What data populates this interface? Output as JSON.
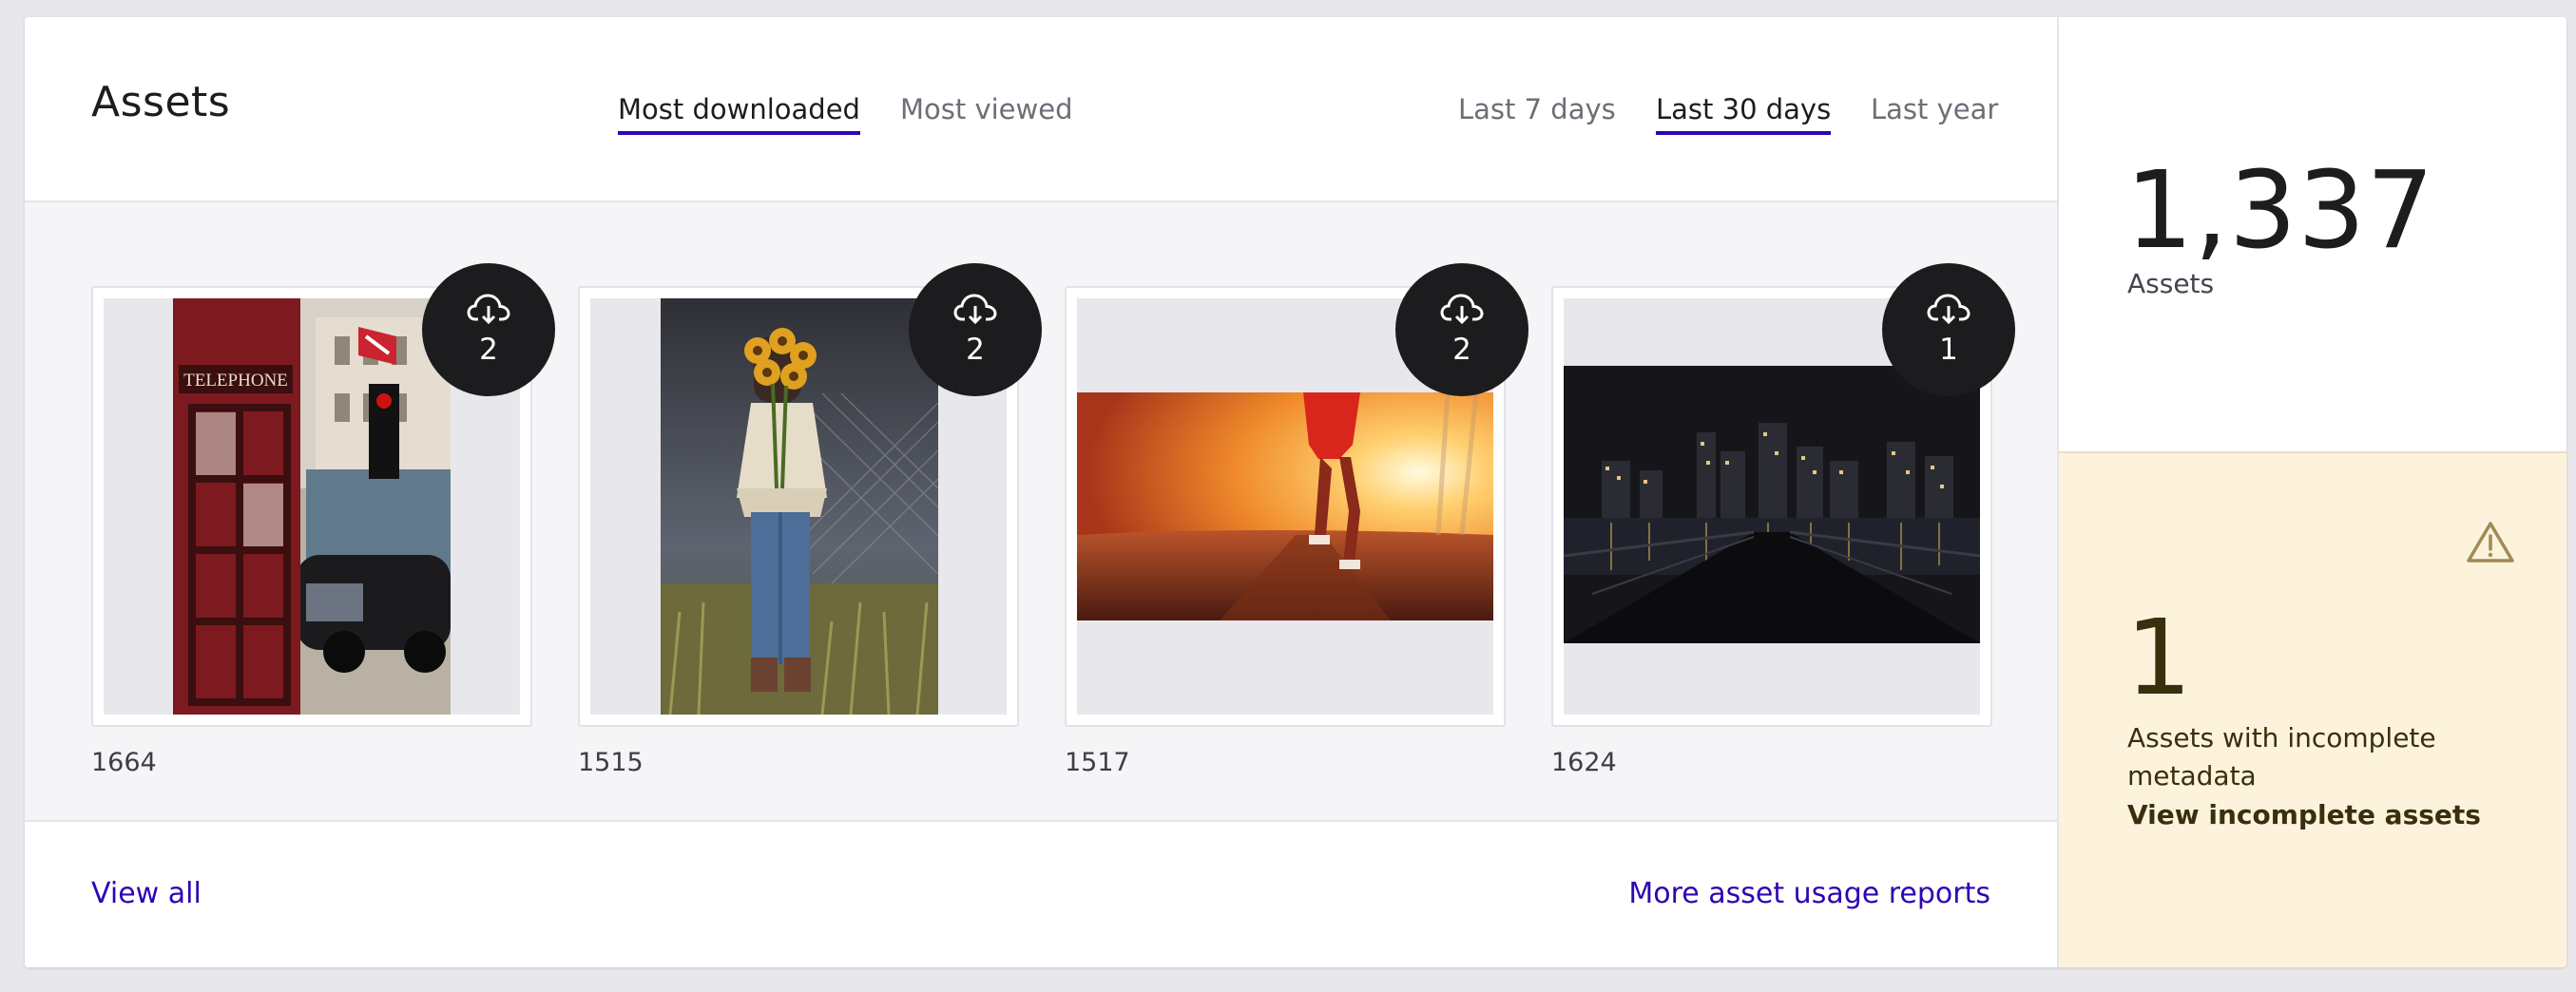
{
  "header": {
    "title": "Assets",
    "metric_tabs": [
      {
        "label": "Most downloaded",
        "active": true
      },
      {
        "label": "Most viewed",
        "active": false
      }
    ],
    "period_tabs": [
      {
        "label": "Last 7 days",
        "active": false
      },
      {
        "label": "Last 30 days",
        "active": true
      },
      {
        "label": "Last year",
        "active": false
      }
    ]
  },
  "assets": [
    {
      "id": "1664",
      "downloads": "2",
      "icon": "cloud-download-icon",
      "image": "red telephone box with taxi"
    },
    {
      "id": "1515",
      "downloads": "2",
      "icon": "cloud-download-icon",
      "image": "person holding sunflowers"
    },
    {
      "id": "1517",
      "downloads": "2",
      "icon": "cloud-download-icon",
      "image": "runner at sunset"
    },
    {
      "id": "1624",
      "downloads": "1",
      "icon": "cloud-download-icon",
      "image": "city skyline at night"
    }
  ],
  "footer": {
    "view_all": "View all",
    "more_reports": "More asset usage reports"
  },
  "summary": {
    "total": "1,337",
    "total_label": "Assets"
  },
  "warning": {
    "icon": "warning-triangle-icon",
    "count": "1",
    "text": "Assets with incomplete metadata",
    "link": "View incomplete assets"
  },
  "colors": {
    "accent": "#2e05b3",
    "badge": "#1c1c1e",
    "warning_bg": "#fdf3dd",
    "panel_bg": "#f5f5f7"
  }
}
